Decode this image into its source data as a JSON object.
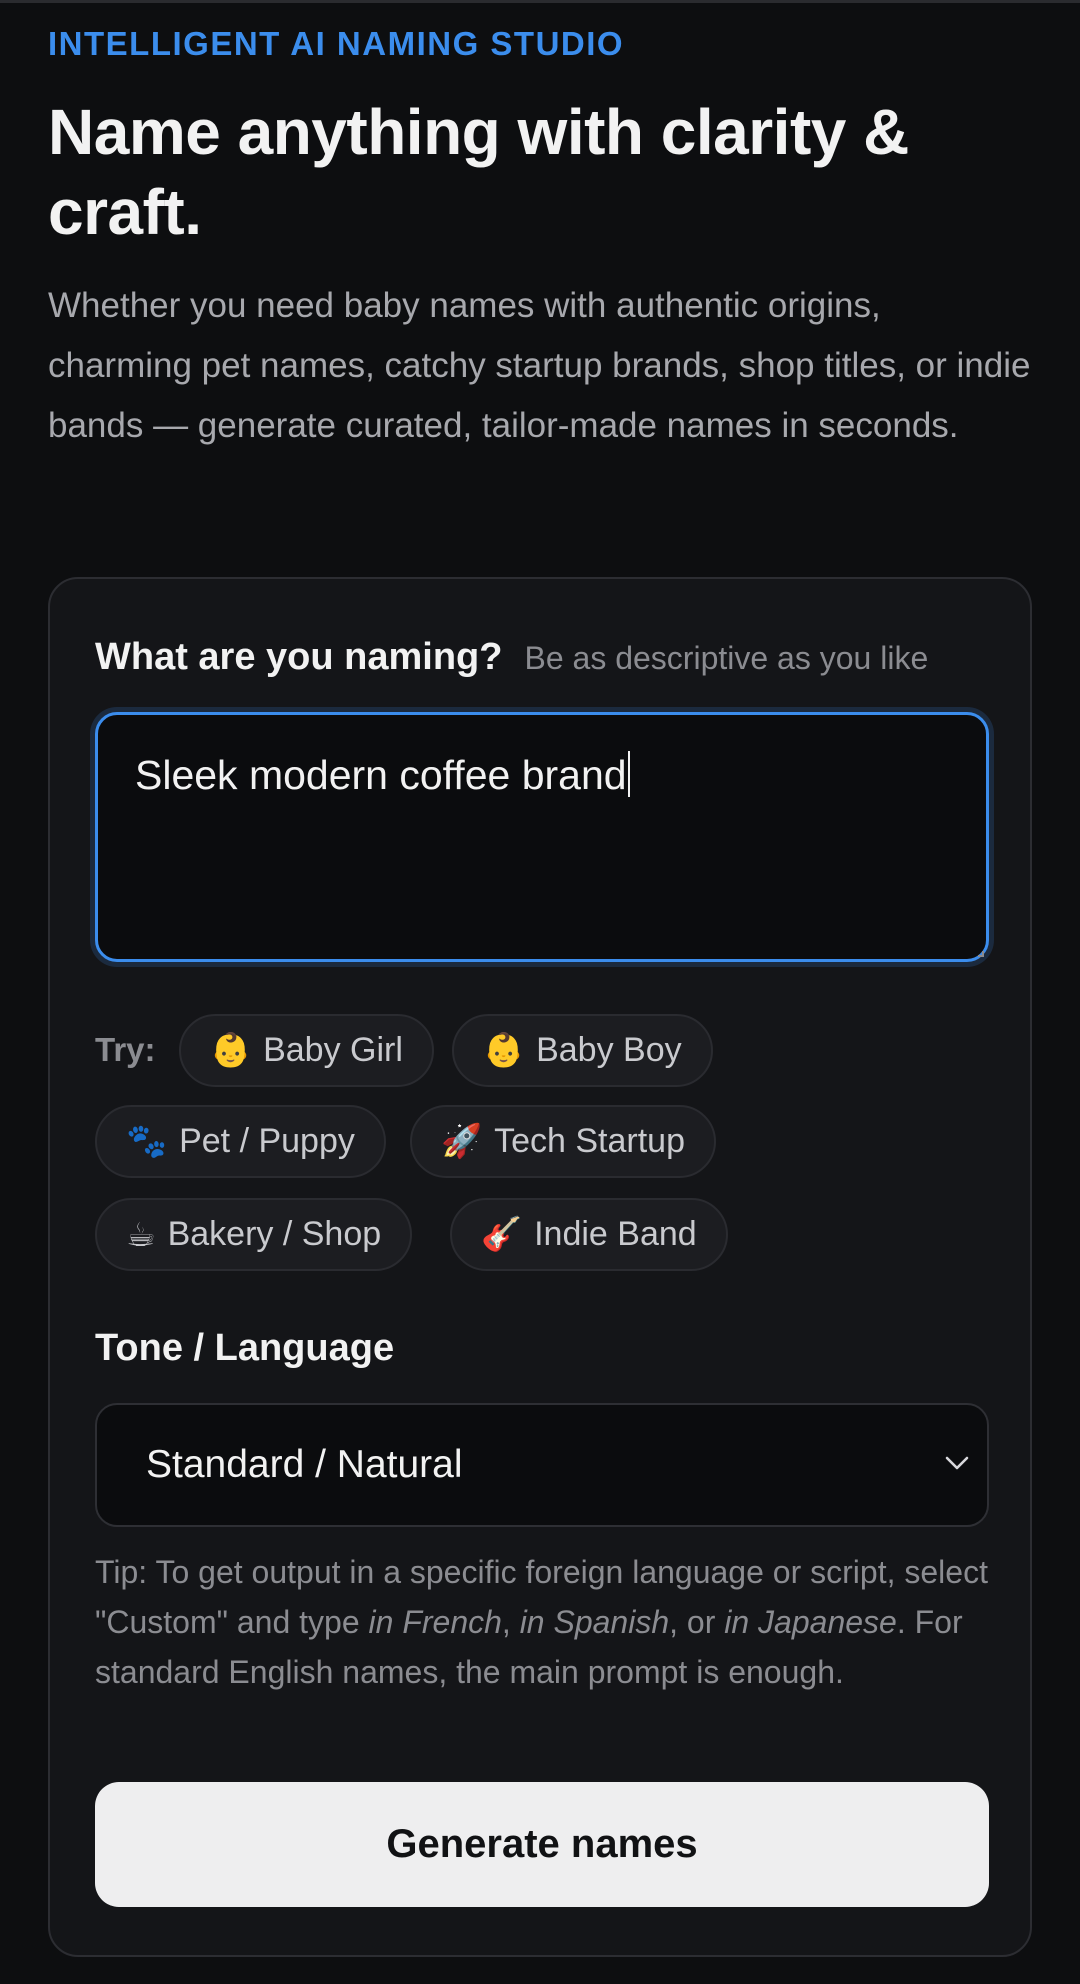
{
  "hero": {
    "eyebrow": "INTELLIGENT AI NAMING STUDIO",
    "title": "Name anything with clarity & craft.",
    "subtitle": "Whether you need baby names with authentic origins, charming pet names, catchy startup brands, shop titles, or indie bands — generate curated, tailor-made names in seconds."
  },
  "form": {
    "naming_label": "What are you naming?",
    "naming_hint": "Be as descriptive as you like",
    "naming_value": "Sleek modern coffee brand",
    "try_label": "Try:",
    "suggestions": [
      {
        "emoji": "👶",
        "label": "Baby Girl"
      },
      {
        "emoji": "👶",
        "label": "Baby Boy"
      },
      {
        "emoji": "🐾",
        "label": "Pet / Puppy"
      },
      {
        "emoji": "🚀",
        "label": "Tech Startup"
      },
      {
        "emoji": "☕",
        "label": "Bakery / Shop"
      },
      {
        "emoji": "🎸",
        "label": "Indie Band"
      }
    ],
    "tone_label": "Tone / Language",
    "tone_value": "Standard / Natural",
    "tip": {
      "part1": "Tip: To get output in a specific foreign language or script, select \"Custom\" and type ",
      "em1": "in French",
      "sep1": ", ",
      "em2": "in Spanish",
      "sep2": ", or ",
      "em3": "in Japanese",
      "part2": ". For standard English names, the main prompt is enough."
    },
    "generate_label": "Generate names"
  },
  "colors": {
    "accent": "#3b8ded",
    "background": "#0d0e10",
    "card": "#141518",
    "button": "#eeeeef"
  }
}
